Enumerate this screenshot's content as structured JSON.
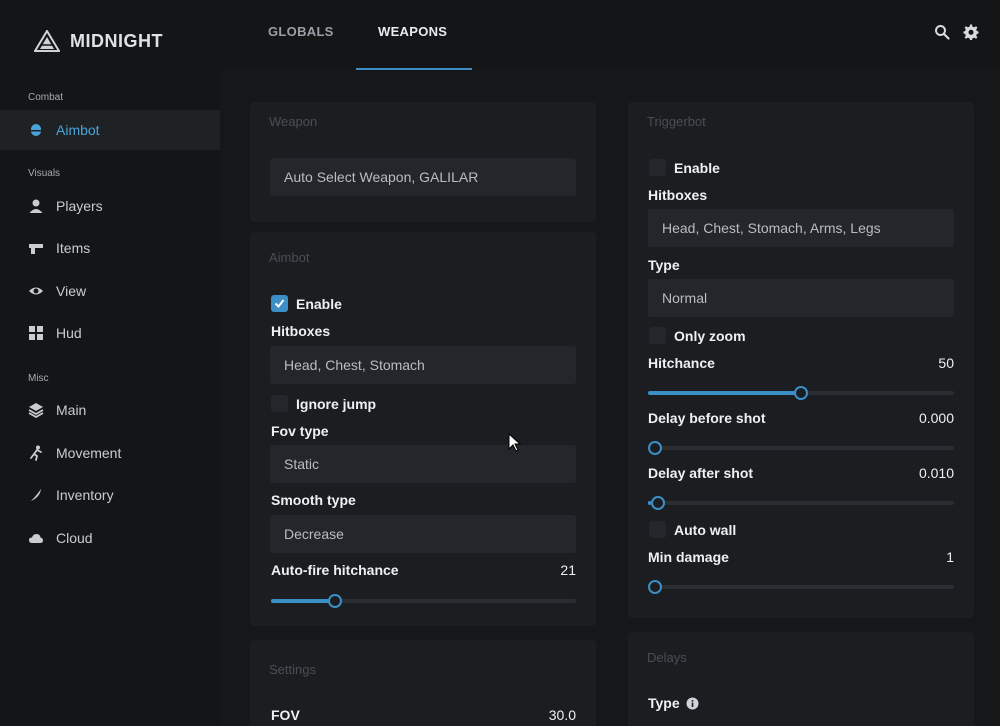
{
  "app": {
    "brand_name": "MIDNIGHT",
    "accent_color": "#3b8fc6"
  },
  "header": {
    "tabs": [
      {
        "label": "GLOBALS",
        "active": false
      },
      {
        "label": "WEAPONS",
        "active": true
      }
    ],
    "icons": [
      "search-icon",
      "gear-icon"
    ]
  },
  "sidebar": {
    "sections": [
      {
        "title": "Combat",
        "items": [
          {
            "label": "Aimbot",
            "icon": "bullet-icon",
            "active": true
          }
        ]
      },
      {
        "title": "Visuals",
        "items": [
          {
            "label": "Players",
            "icon": "person-icon"
          },
          {
            "label": "Items",
            "icon": "gun-icon"
          },
          {
            "label": "View",
            "icon": "eye-icon"
          },
          {
            "label": "Hud",
            "icon": "grid-icon"
          }
        ]
      },
      {
        "title": "Misc",
        "items": [
          {
            "label": "Main",
            "icon": "layers-icon"
          },
          {
            "label": "Movement",
            "icon": "running-icon"
          },
          {
            "label": "Inventory",
            "icon": "knife-icon"
          },
          {
            "label": "Cloud",
            "icon": "cloud-icon"
          }
        ]
      }
    ]
  },
  "weapon_panel": {
    "title": "Weapon",
    "select_value": "Auto Select Weapon, GALILAR"
  },
  "aimbot_panel": {
    "title": "Aimbot",
    "enable_label": "Enable",
    "enable_checked": true,
    "hitboxes_label": "Hitboxes",
    "hitboxes_value": "Head, Chest, Stomach",
    "ignore_jump_label": "Ignore jump",
    "ignore_jump_checked": false,
    "fov_type_label": "Fov type",
    "fov_type_value": "Static",
    "smooth_type_label": "Smooth type",
    "smooth_type_value": "Decrease",
    "autofire_label": "Auto-fire hitchance",
    "autofire_value": "21",
    "autofire_fraction": 0.21
  },
  "settings_panel": {
    "title": "Settings",
    "fov_label": "FOV",
    "fov_value": "30.0"
  },
  "triggerbot_panel": {
    "title": "Triggerbot",
    "enable_label": "Enable",
    "enable_checked": false,
    "hitboxes_label": "Hitboxes",
    "hitboxes_value": "Head, Chest, Stomach, Arms, Legs",
    "type_label": "Type",
    "type_value": "Normal",
    "only_zoom_label": "Only zoom",
    "only_zoom_checked": false,
    "hitchance_label": "Hitchance",
    "hitchance_value": "50",
    "hitchance_fraction": 0.5,
    "delay_before_label": "Delay before shot",
    "delay_before_value": "0.000",
    "delay_before_fraction": 0.0,
    "delay_after_label": "Delay after shot",
    "delay_after_value": "0.010",
    "delay_after_fraction": 0.01,
    "auto_wall_label": "Auto wall",
    "auto_wall_checked": false,
    "min_damage_label": "Min damage",
    "min_damage_value": "1",
    "min_damage_fraction": 0.0
  },
  "delays_panel": {
    "title": "Delays",
    "type_label": "Type"
  }
}
